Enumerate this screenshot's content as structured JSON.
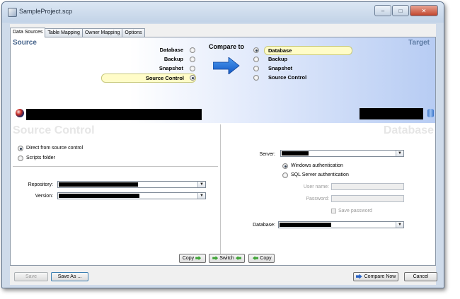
{
  "window": {
    "title": "SampleProject.scp",
    "controls": {
      "minimize": "–",
      "maximize": "□",
      "close": "✕"
    }
  },
  "tabs": [
    {
      "label": "Data Sources",
      "active": true
    },
    {
      "label": "Table Mapping",
      "active": false
    },
    {
      "label": "Owner Mapping",
      "active": false
    },
    {
      "label": "Options",
      "active": false
    }
  ],
  "banner": {
    "source_heading": "Source",
    "target_heading": "Target",
    "compare_to": "Compare to",
    "source_options": [
      {
        "label": "Database",
        "selected": false
      },
      {
        "label": "Backup",
        "selected": false
      },
      {
        "label": "Snapshot",
        "selected": false
      },
      {
        "label": "Source Control",
        "selected": true
      }
    ],
    "target_options": [
      {
        "label": "Database",
        "selected": true
      },
      {
        "label": "Backup",
        "selected": false
      },
      {
        "label": "Snapshot",
        "selected": false
      },
      {
        "label": "Source Control",
        "selected": false
      }
    ]
  },
  "source_pane": {
    "title": "Source Control",
    "mode_options": [
      {
        "label": "Direct from source control",
        "selected": true
      },
      {
        "label": "Scripts folder",
        "selected": false
      }
    ],
    "repository_label": "Repository:",
    "version_label": "Version:"
  },
  "target_pane": {
    "title": "Database",
    "server_label": "Server:",
    "auth_options": [
      {
        "label": "Windows authentication",
        "selected": true
      },
      {
        "label": "SQL Server authentication",
        "selected": false
      }
    ],
    "username_label": "User name:",
    "password_label": "Password:",
    "save_password_label": "Save password",
    "database_label": "Database:"
  },
  "middle_buttons": {
    "copy_right": "Copy",
    "switch": "Switch",
    "copy_left": "Copy"
  },
  "footer": {
    "save": "Save",
    "save_as": "Save As ...",
    "compare_now": "Compare Now",
    "cancel": "Cancel"
  },
  "colors": {
    "accent": "#2a63c4",
    "highlight": "#fffcc8",
    "frame": "#cfdbea"
  }
}
